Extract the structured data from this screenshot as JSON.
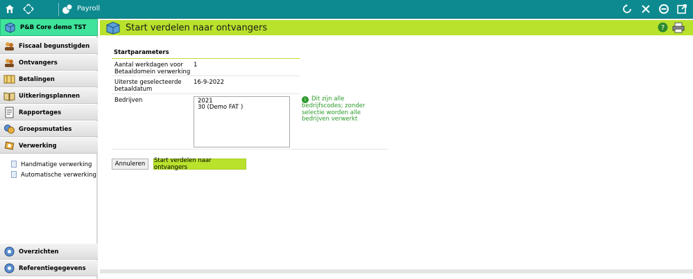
{
  "app": {
    "title": "Payroll"
  },
  "sidebar": {
    "header": "P&B Core demo TST",
    "items": [
      {
        "label": "Fiscaal begunstigden",
        "icon": "people-icon"
      },
      {
        "label": "Ontvangers",
        "icon": "people-icon"
      },
      {
        "label": "Betalingen",
        "icon": "ledger-icon"
      },
      {
        "label": "Uitkeringsplannen",
        "icon": "book-icon"
      },
      {
        "label": "Rapportages",
        "icon": "report-icon"
      },
      {
        "label": "Groepsmutaties",
        "icon": "coins-icon"
      },
      {
        "label": "Verwerking",
        "icon": "process-icon"
      }
    ],
    "subitems": [
      {
        "label": "Handmatige verwerking"
      },
      {
        "label": "Automatische verwerking"
      }
    ],
    "bottom": [
      {
        "label": "Overzichten"
      },
      {
        "label": "Referentiegegevens"
      }
    ]
  },
  "page": {
    "title": "Start verdelen naar ontvangers"
  },
  "form": {
    "section_title": "Startparameters",
    "fields": [
      {
        "label_line1": "Aantal werkdagen voor",
        "label_line2": "Betaaldomein verwerking",
        "value": "1"
      },
      {
        "label_line1": "Uiterste geselecteerde",
        "label_line2": "betaaldatum",
        "value": "16-9-2022"
      },
      {
        "label_line1": "Bedrijven",
        "label_line2": "",
        "value": ""
      }
    ],
    "companies": [
      "2021",
      "30 (Demo FAT )"
    ],
    "hint": "Dit zijn alle bedrijfscodes; zonder selectie worden alle bedrijven verwerkt"
  },
  "buttons": {
    "cancel": "Annuleren",
    "start": "Start verdelen naar ontvangers"
  },
  "colors": {
    "topbar": "#0d8a8f",
    "accent": "#b9e22c",
    "sidebar_header": "#3fe39b",
    "hint": "#2b9a2b"
  }
}
